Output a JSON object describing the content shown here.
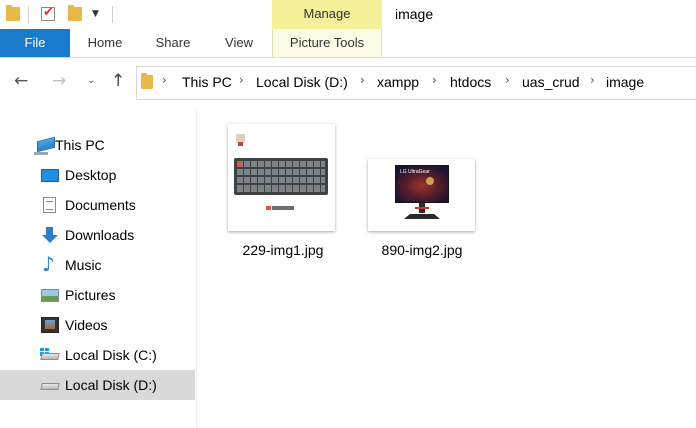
{
  "window": {
    "title": "image"
  },
  "ribbon": {
    "context_group": "Manage",
    "tabs": [
      {
        "label": "File"
      },
      {
        "label": "Home"
      },
      {
        "label": "Share"
      },
      {
        "label": "View"
      },
      {
        "label": "Picture Tools"
      }
    ]
  },
  "address": {
    "crumbs": [
      "This PC",
      "Local Disk (D:)",
      "xampp",
      "htdocs",
      "uas_crud",
      "image"
    ]
  },
  "nav_pane": {
    "items": [
      {
        "label": "This PC",
        "icon": "this-pc-icon"
      },
      {
        "label": "Desktop",
        "icon": "desktop-icon"
      },
      {
        "label": "Documents",
        "icon": "documents-icon"
      },
      {
        "label": "Downloads",
        "icon": "downloads-icon"
      },
      {
        "label": "Music",
        "icon": "music-icon"
      },
      {
        "label": "Pictures",
        "icon": "pictures-icon"
      },
      {
        "label": "Videos",
        "icon": "videos-icon"
      },
      {
        "label": "Local Disk (C:)",
        "icon": "system-drive-icon"
      },
      {
        "label": "Local Disk (D:)",
        "icon": "drive-icon",
        "selected": true
      }
    ]
  },
  "files": [
    {
      "name": "229-img1.jpg",
      "thumbnail": "keyboard-thumbnail"
    },
    {
      "name": "890-img2.jpg",
      "thumbnail": "monitor-thumbnail",
      "thumbnail_text": "LG UltraGear"
    }
  ],
  "colors": {
    "accent": "#1979ca",
    "context_tab": "#f4f19a",
    "selection": "#d9d9d9"
  }
}
